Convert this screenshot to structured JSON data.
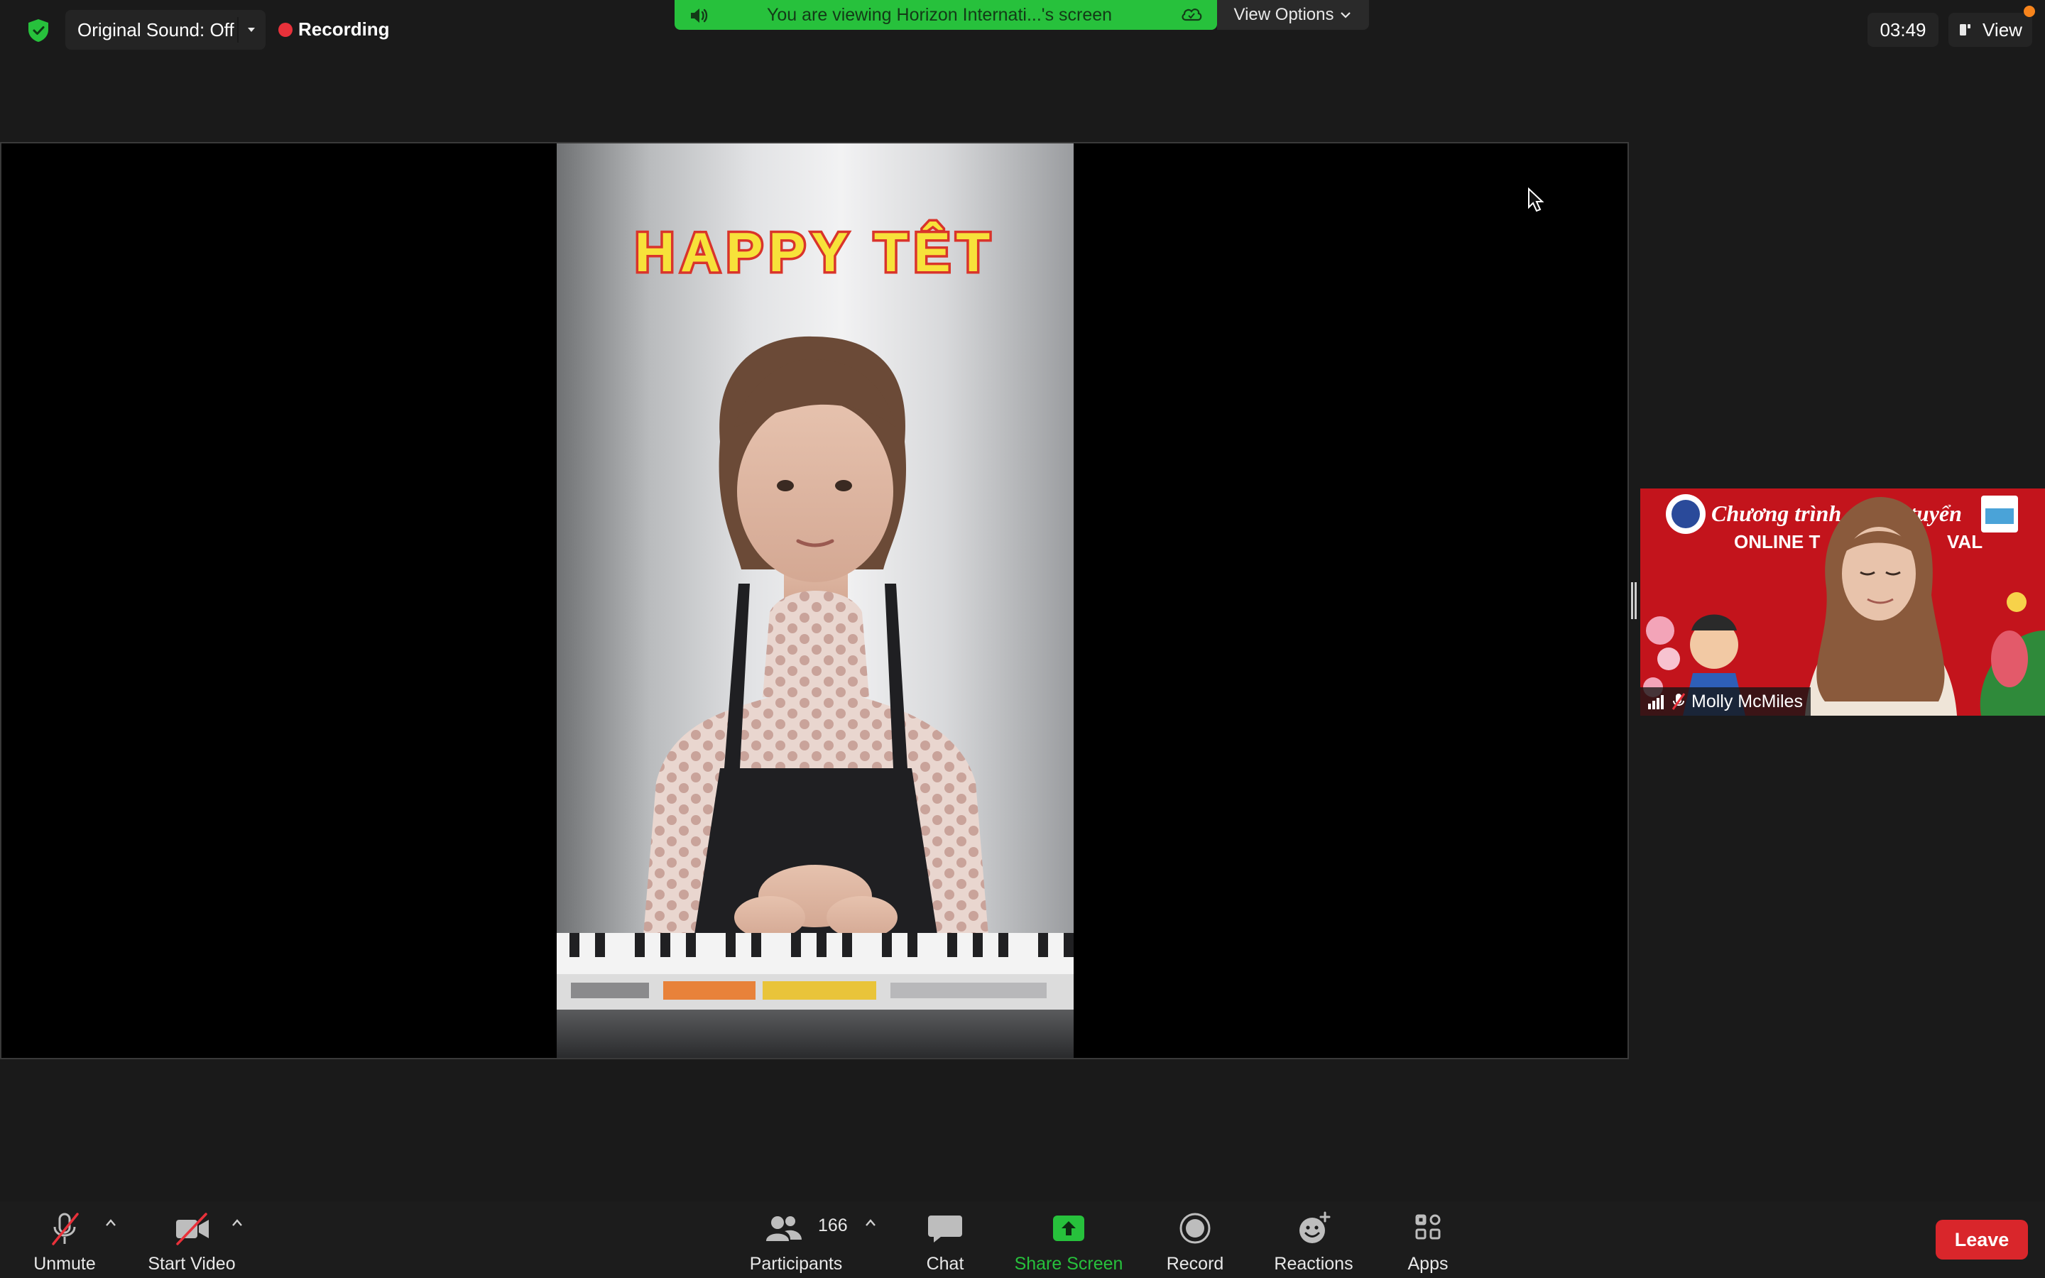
{
  "topbar": {
    "original_sound_label": "Original Sound: Off",
    "recording_label": "Recording",
    "viewing_banner_text": "You are viewing Horizon Internati...'s screen",
    "view_options_label": "View Options",
    "timer": "03:49",
    "view_label": "View"
  },
  "shared_video": {
    "caption": "HAPPY TÊT"
  },
  "participant_tile": {
    "name": "Molly McMiles",
    "background_text_line1": "Chương trình",
    "background_text_line1b": "tuyển",
    "background_text_line2": "ONLINE T",
    "background_text_line2b": "VAL"
  },
  "toolbar": {
    "unmute_label": "Unmute",
    "start_video_label": "Start Video",
    "participants_label": "Participants",
    "participants_count": "166",
    "chat_label": "Chat",
    "share_screen_label": "Share Screen",
    "record_label": "Record",
    "reactions_label": "Reactions",
    "apps_label": "Apps",
    "leave_label": "Leave"
  },
  "colors": {
    "banner_green": "#27c13c",
    "leave_red": "#d9262b",
    "recording_red": "#e8313a",
    "notification_orange": "#f7841c"
  }
}
